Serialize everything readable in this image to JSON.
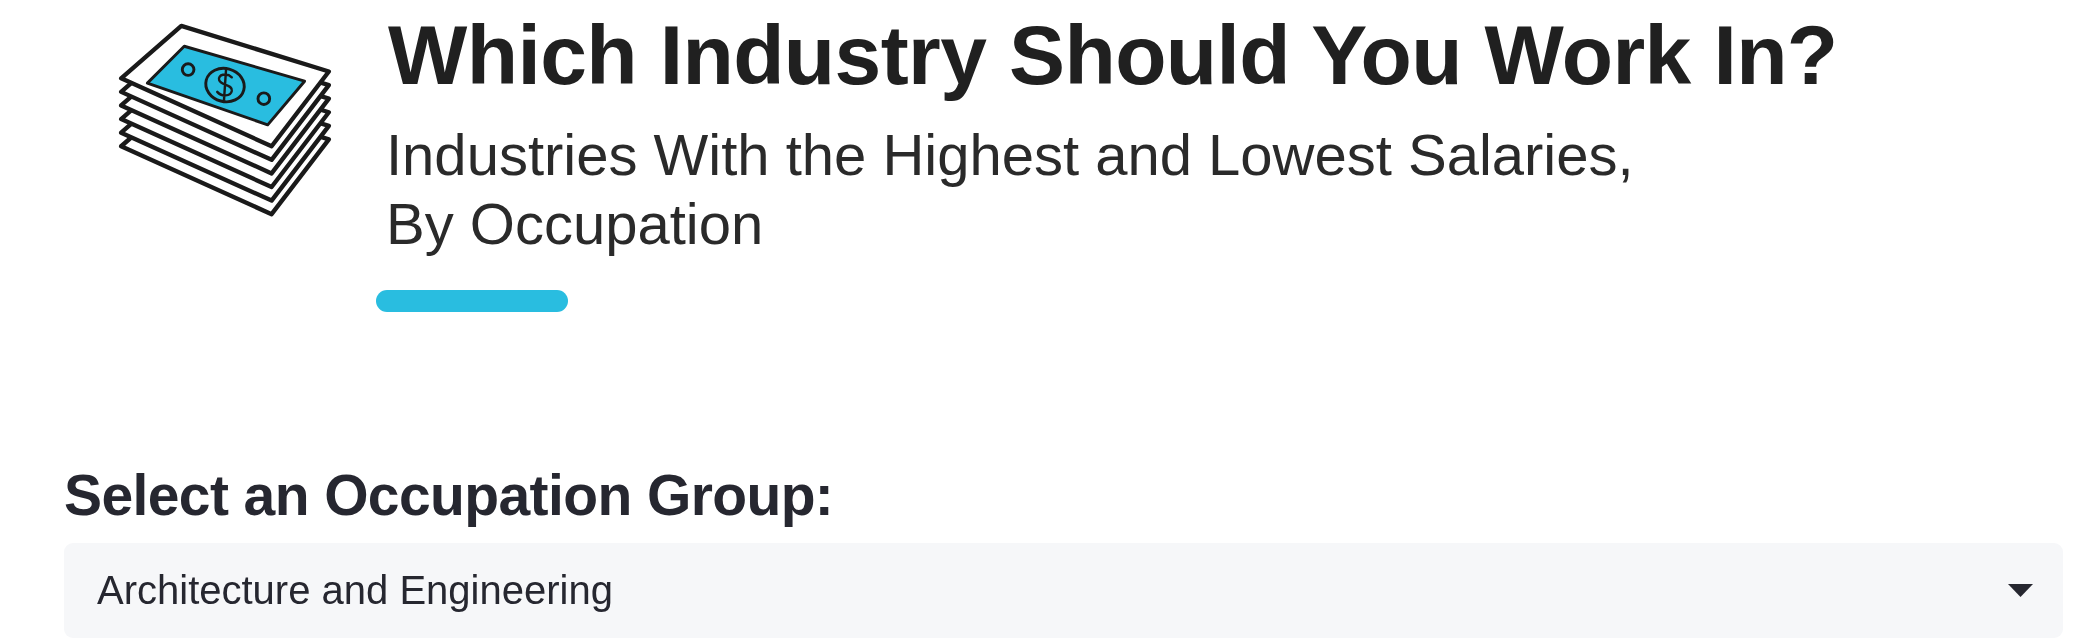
{
  "header": {
    "title": "Which Industry Should You Work In?",
    "subtitle_lines": [
      "Industries With the Highest and Lowest Salaries,",
      "By Occupation"
    ]
  },
  "occupation_select": {
    "label": "Select an Occupation Group:",
    "value": "Architecture and Engineering"
  }
}
